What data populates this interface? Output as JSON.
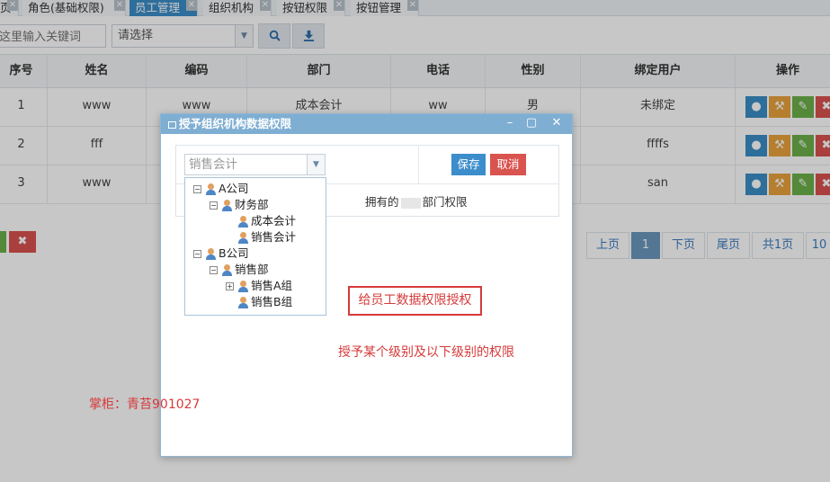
{
  "tabs": [
    {
      "label": "页",
      "active": false
    },
    {
      "label": "角色(基础权限)",
      "active": false
    },
    {
      "label": "员工管理",
      "active": true
    },
    {
      "label": "组织机构",
      "active": false
    },
    {
      "label": "按钮权限",
      "active": false
    },
    {
      "label": "按钮管理",
      "active": false
    }
  ],
  "toolbar": {
    "keyword_placeholder": "这里输入关键词",
    "select_value": "请选择"
  },
  "table": {
    "headers": [
      "序号",
      "姓名",
      "编码",
      "部门",
      "电话",
      "性别",
      "绑定用户",
      "操作"
    ],
    "rows": [
      [
        "1",
        "www",
        "www",
        "成本会计",
        "ww",
        "男",
        "未绑定"
      ],
      [
        "2",
        "fff",
        "",
        "",
        "",
        "",
        "ffffs"
      ],
      [
        "3",
        "www",
        "",
        "",
        "",
        "",
        "san"
      ]
    ]
  },
  "pager": {
    "prev": "上页",
    "current": "1",
    "next": "下页",
    "last": "尾页",
    "total": "共1页",
    "size": "10"
  },
  "dialog": {
    "title": "授予组织机构数据权限",
    "combo_value": "销售会计",
    "save_label": "保存",
    "cancel_label": "取消",
    "hint_prefix": "拥有的",
    "hint_suffix": "部门权限"
  },
  "tree": [
    {
      "label": "A公司",
      "toggle": "−"
    },
    {
      "label": "财务部",
      "toggle": "−"
    },
    {
      "label": "成本会计",
      "toggle": ""
    },
    {
      "label": "销售会计",
      "toggle": ""
    },
    {
      "label": "B公司",
      "toggle": "−"
    },
    {
      "label": "销售部",
      "toggle": "−"
    },
    {
      "label": "销售A组",
      "toggle": "+"
    },
    {
      "label": "销售B组",
      "toggle": ""
    }
  ],
  "annotations": {
    "redbox": "给员工数据权限授权",
    "note": "授予某个级别及以下级别的权限",
    "shop": "掌柜：青苔901027"
  },
  "colors": {
    "accent": "#3b8ec8",
    "dialog_title": "#7faed3",
    "save": "#3c8dcb",
    "cancel": "#d9534f",
    "annotation_red": "#d63a3a"
  }
}
